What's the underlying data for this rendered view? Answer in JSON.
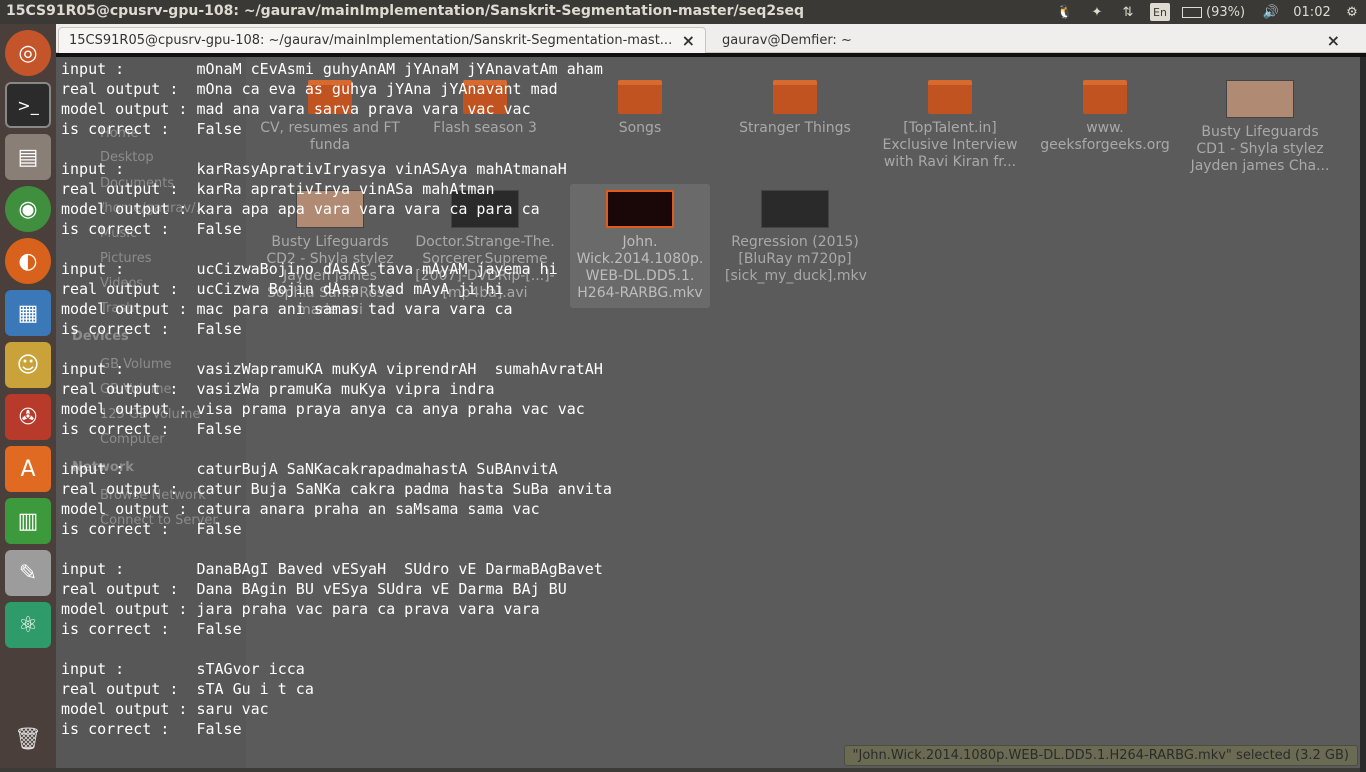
{
  "top_panel": {
    "title": "15CS91R05@cpusrv-gpu-108: ~/gaurav/mainImplementation/Sanskrit-Segmentation-master/seq2seq",
    "lang": "En",
    "battery": "(93%)",
    "clock": "01:02"
  },
  "launcher": {
    "items": [
      "ubuntu-dash",
      "terminal",
      "files",
      "chrome",
      "firefox",
      "image-viewer",
      "pidgin",
      "system-settings",
      "software-center",
      "spreadsheet",
      "text-editor",
      "atom",
      "trash"
    ]
  },
  "tabs": [
    {
      "label": "15CS91R05@cpusrv-gpu-108: ~/gaurav/mainImplementation/Sanskrit-Segmentation-mast..."
    },
    {
      "label": "gaurav@Demfier: ~"
    }
  ],
  "file_manager": {
    "sidebar": [
      "Home",
      "Desktop",
      "Documents",
      "/home/gaurav/...",
      "Music",
      "Pictures",
      "Videos",
      "Trash"
    ],
    "devices_heading": "Devices",
    "devices": [
      "GB Volume",
      "GB Volume",
      "125 GB Volume",
      "Computer"
    ],
    "network_heading": "Network",
    "network": [
      "Browse Network",
      "Connect to Server"
    ],
    "items": [
      {
        "label": "CV, resumes and FT funda",
        "kind": "folder"
      },
      {
        "label": "Flash season 3",
        "kind": "folder"
      },
      {
        "label": "Songs",
        "kind": "folder"
      },
      {
        "label": "Stranger Things",
        "kind": "folder"
      },
      {
        "label": "[TopTalent.in] Exclusive Interview with Ravi Kiran fr...",
        "kind": "folder"
      },
      {
        "label": "www. geeksforgeeks.org",
        "kind": "folder"
      },
      {
        "label": "Busty Lifeguards CD1 - Shyla stylez Jayden james Cha...",
        "kind": "video"
      },
      {
        "label": "Busty Lifeguards CD2 - Shyla stylez Jayden james Sophia Santi Rose marie.avi",
        "kind": "video"
      },
      {
        "label": "Doctor.Strange-The. Sorcerer.Supreme [2007]-DVDRip-[...]-[mp4ba].avi",
        "kind": "video"
      },
      {
        "label": "John. Wick.2014.1080p. WEB-DL.DD5.1. H264-RARBG.mkv",
        "kind": "video",
        "selected": true
      },
      {
        "label": "Regression (2015) [BluRay m720p] [sick_my_duck].mkv",
        "kind": "video"
      }
    ],
    "status": "\"John.Wick.2014.1080p.WEB-DL.DD5.1.H264-RARBG.mkv\" selected  (3.2 GB)"
  },
  "terminal": {
    "lines": [
      "input :        mOnaM cEvAsmi guhyAnAM jYAnaM jYAnavatAm aham",
      "real output :  mOna ca eva as guhya jYAna jYAnavant mad",
      "model output : mad ana vara sarva prava vara vac vac",
      "is correct :   False",
      "",
      "input :        karRasyAprativIryasya vinASAya mahAtmanaH",
      "real output :  karRa aprativIrya vinASa mahAtman",
      "model output : kara apa apa vara vara vara ca para ca",
      "is correct :   False",
      "",
      "input :        ucCizwaBojino dAsAs tava mAyAM jayema hi",
      "real output :  ucCizwa Bojin dAsa tvad mAyA ji hi",
      "model output : mac para ani samas tad vara vara ca",
      "is correct :   False",
      "",
      "input :        vasizWapramuKA muKyA viprendrAH  sumahAvratAH",
      "real output :  vasizWa pramuKa muKya vipra indra",
      "model output : visa prama praya anya ca anya praha vac vac",
      "is correct :   False",
      "",
      "input :        caturBujA SaNKacakrapadmahastA SuBAnvitA",
      "real output :  catur Buja SaNKa cakra padma hasta SuBa anvita",
      "model output : catura anara praha an saMsama sama vac",
      "is correct :   False",
      "",
      "input :        DanaBAgI Baved vESyaH  SUdro vE DarmaBAgBavet",
      "real output :  Dana BAgin BU vESya SUdra vE Darma BAj BU",
      "model output : jara praha vac para ca prava vara vara",
      "is correct :   False",
      "",
      "input :        sTAGvor icca",
      "real output :  sTA Gu i t ca",
      "model output : saru vac",
      "is correct :   False"
    ]
  }
}
